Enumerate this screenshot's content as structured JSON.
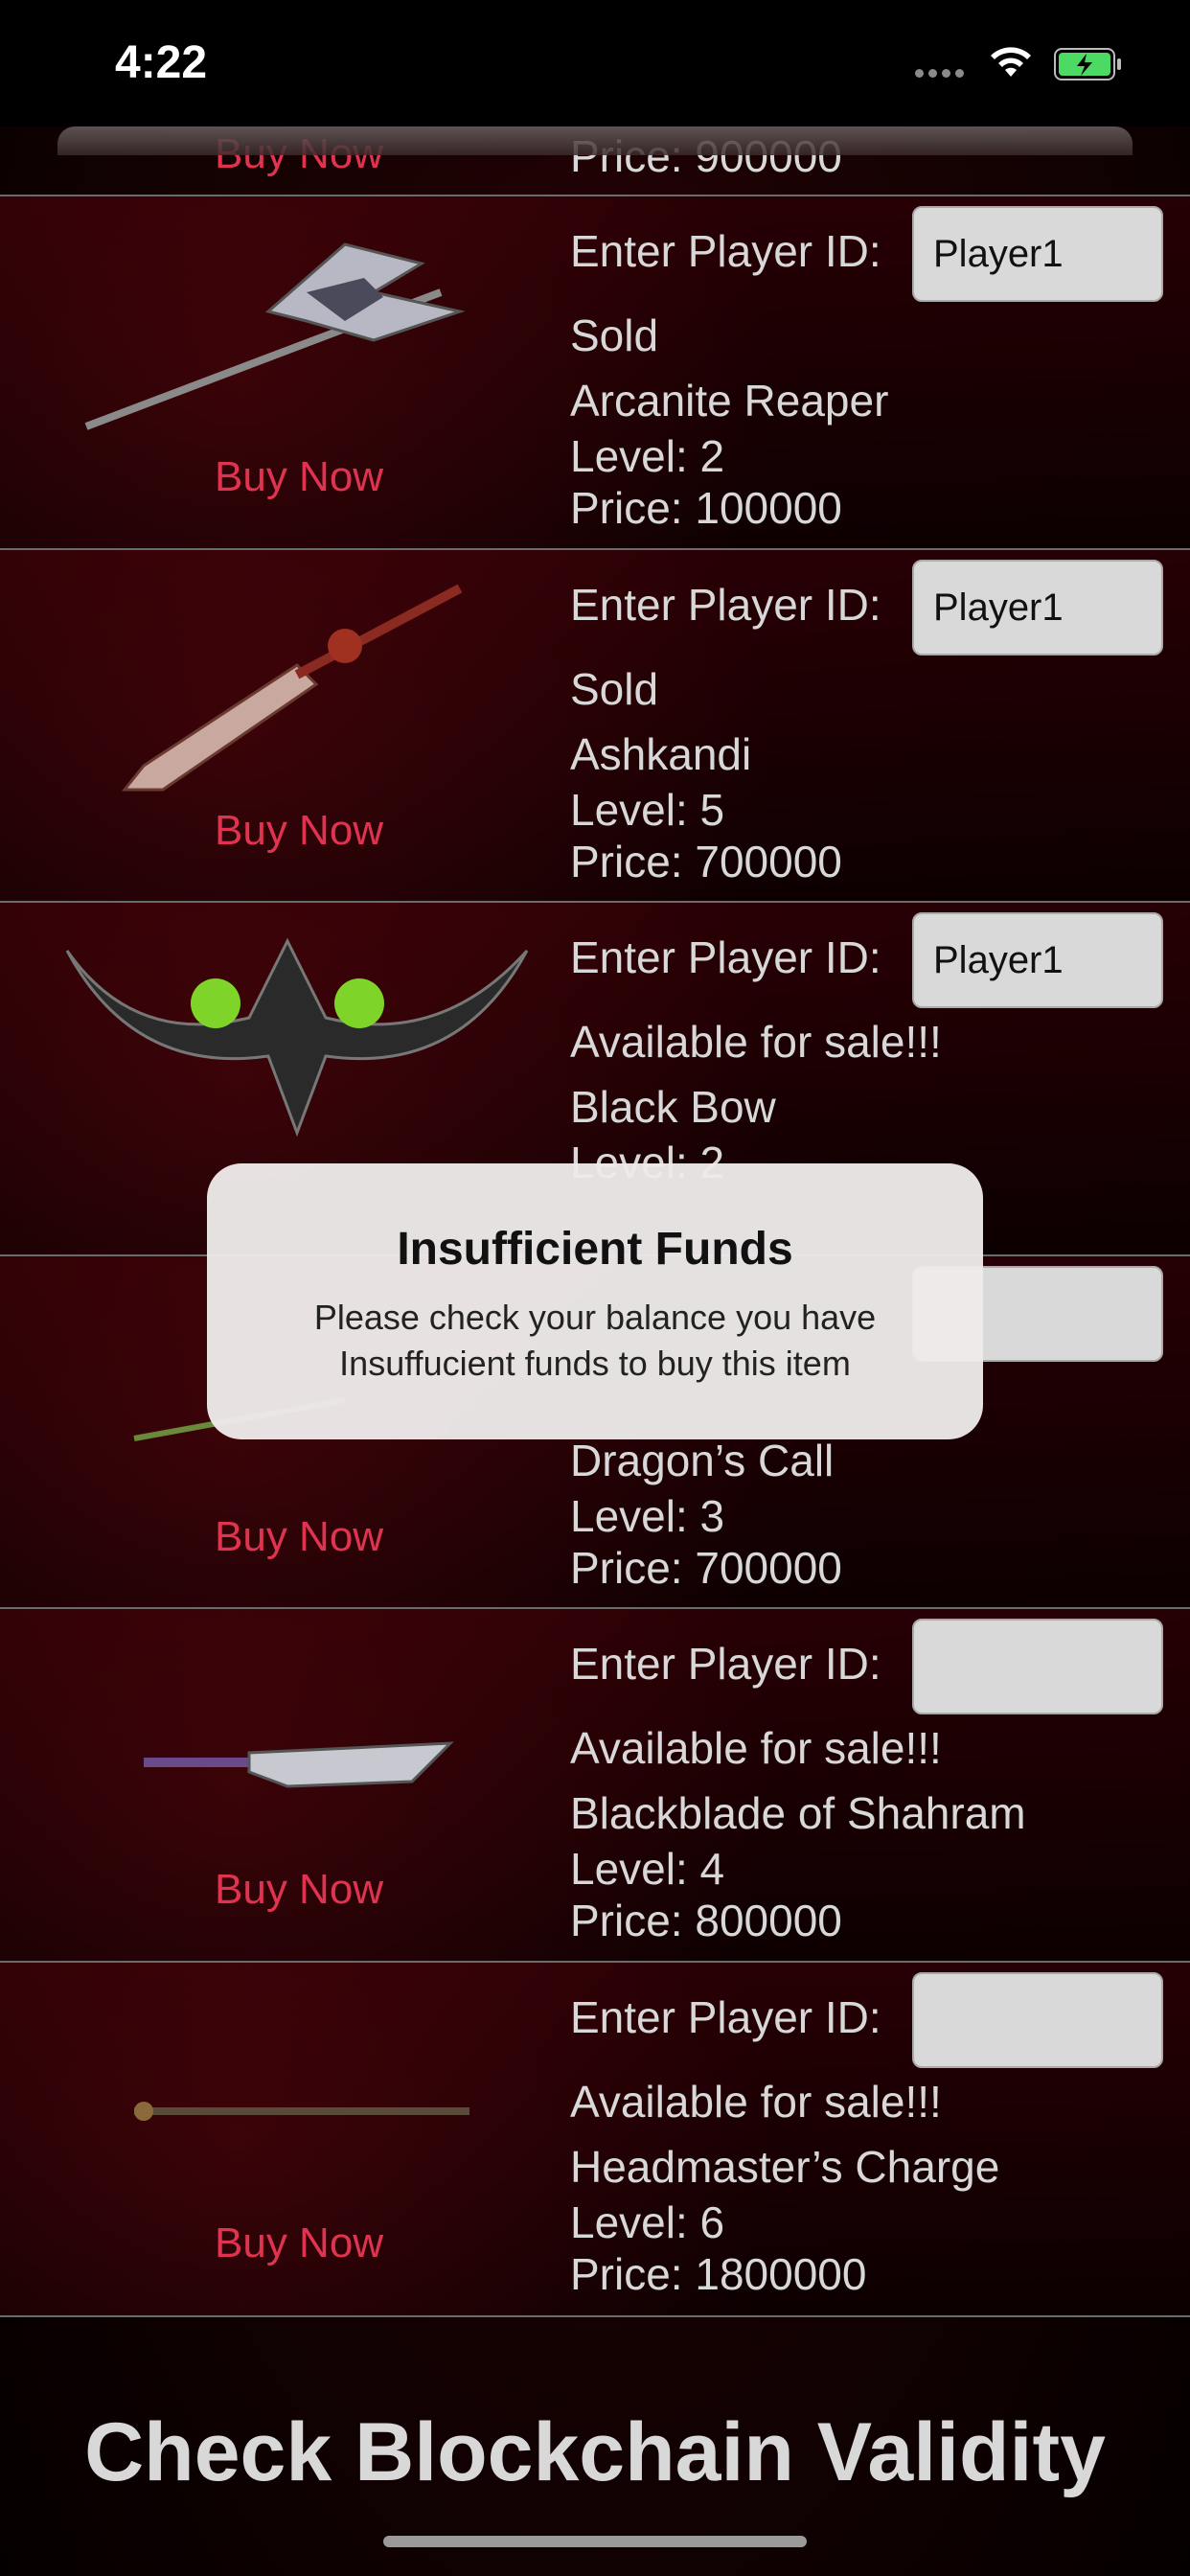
{
  "status_bar": {
    "time": "4:22"
  },
  "top_partial": {
    "buy_label": "Buy Now",
    "price": "Price:  900000"
  },
  "player_id_label": "Enter Player ID:",
  "items": [
    {
      "name": "Arcanite Reaper",
      "status": "Sold",
      "level": "Level: 2",
      "price": "Price:  100000",
      "player_id": "Player1",
      "buy_label": "Buy Now"
    },
    {
      "name": "Ashkandi",
      "status": "Sold",
      "level": "Level: 5",
      "price": "Price:  700000",
      "player_id": "Player1",
      "buy_label": "Buy Now"
    },
    {
      "name": "Black Bow",
      "status": "Available for sale!!!",
      "level": "Level: 2",
      "price": "",
      "player_id": "Player1",
      "buy_label": ""
    },
    {
      "name": "Dragon’s Call",
      "status": "",
      "level": "Level: 3",
      "price": "Price:  700000",
      "player_id": "",
      "buy_label": "Buy Now"
    },
    {
      "name": "Blackblade of Shahram",
      "status": "Available for sale!!!",
      "level": "Level: 4",
      "price": "Price:  800000",
      "player_id": "",
      "buy_label": "Buy Now"
    },
    {
      "name": "Headmaster’s Charge",
      "status": "Available for sale!!!",
      "level": "Level: 6",
      "price": "Price:  1800000",
      "player_id": "",
      "buy_label": "Buy Now"
    }
  ],
  "alert": {
    "title": "Insufficient Funds",
    "message_line1": "Please check your balance you have",
    "message_line2": "Insuffucient funds to buy this item"
  },
  "footer": {
    "button_label": "Check Blockchain Validity"
  },
  "colors": {
    "accent": "#e0334f",
    "battery": "#4cd964"
  }
}
